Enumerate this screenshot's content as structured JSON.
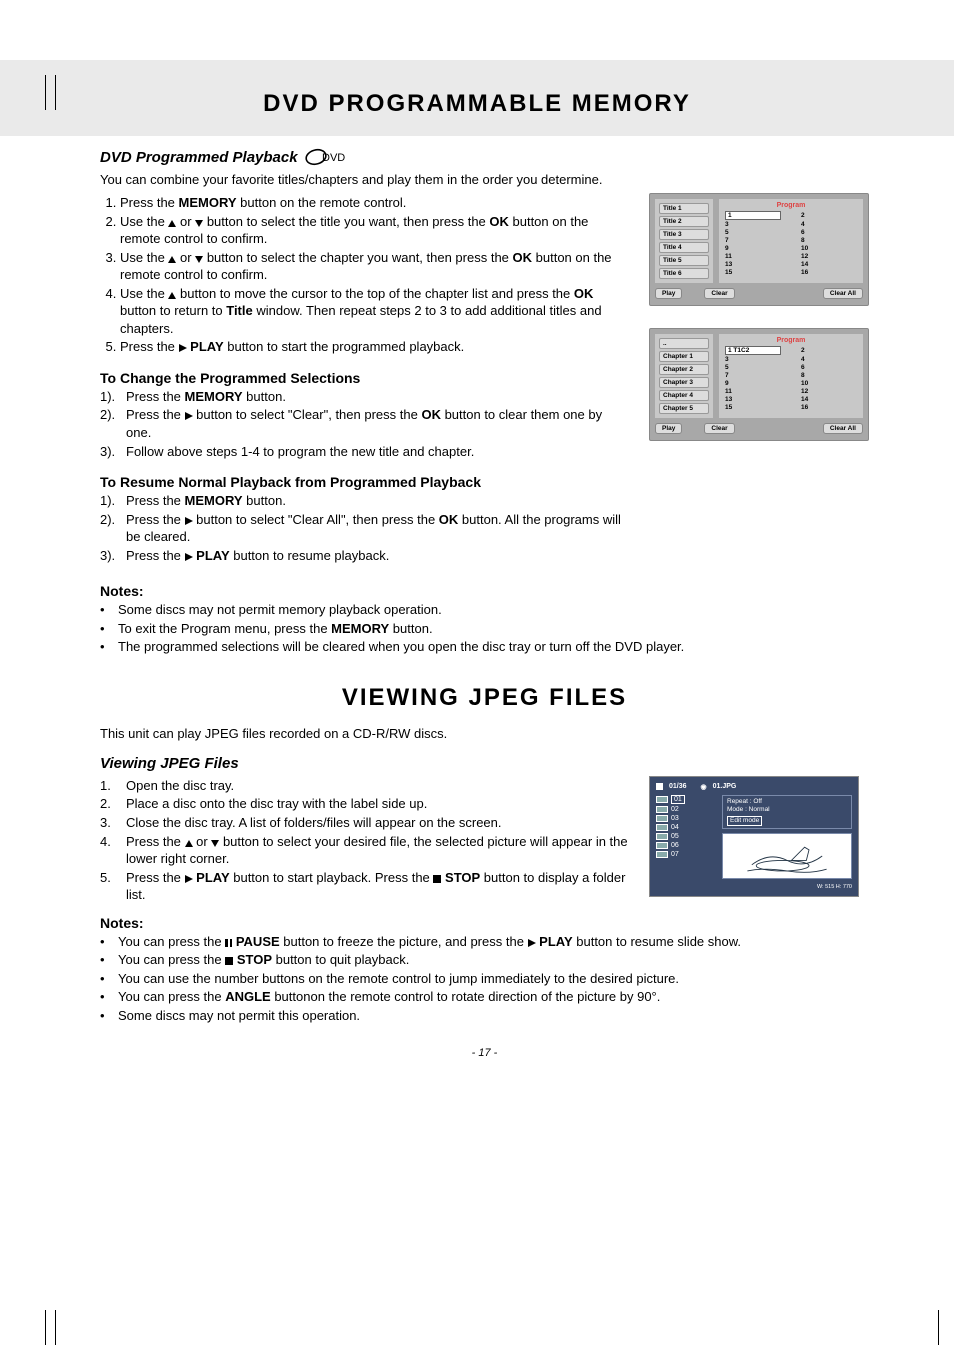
{
  "header1": "DVD PROGRAMMABLE MEMORY",
  "sec1": {
    "title": "DVD Programmed Playback",
    "badge": "DVD",
    "intro": "You can combine your favorite titles/chapters and play them in the order you determine.",
    "step1_a": "Press the ",
    "step1_b": "MEMORY",
    "step1_c": " button on the remote control.",
    "step2_a": "Use the ",
    "step2_b": " or ",
    "step2_c": " button to select the title you want, then press the ",
    "step2_d": "OK",
    "step2_e": " button on the remote control to confirm.",
    "step3_a": "Use the ",
    "step3_b": " or ",
    "step3_c": " button to select the chapter you want, then press the ",
    "step3_d": "OK",
    "step3_e": " button on the remote control to confirm.",
    "step4_a": "Use the ",
    "step4_b": " button to move the cursor to the top of the chapter list and press the ",
    "step4_c": "OK",
    "step4_d": " button to return to ",
    "step4_e": "Title",
    "step4_f": " window. Then repeat steps 2 to 3 to add additional titles and chapters.",
    "step5_a": "Press the ",
    "step5_b": " PLAY",
    "step5_c": " button to start the programmed playback."
  },
  "change": {
    "h": "To Change the Programmed Selections",
    "s1a": "Press the ",
    "s1b": "MEMORY",
    "s1c": " button.",
    "s2a": "Press the ",
    "s2b": " button to select \"Clear\", then press the ",
    "s2c": "OK",
    "s2d": " button to clear them one by one.",
    "s3": "Follow above steps 1-4 to program the new title and chapter."
  },
  "resume": {
    "h": "To Resume Normal Playback from Programmed Playback",
    "s1a": "Press the ",
    "s1b": "MEMORY",
    "s1c": " button.",
    "s2a": "Press the ",
    "s2b": " button to select \"Clear All\", then press the ",
    "s2c": "OK",
    "s2d": " button. All the programs will be cleared.",
    "s3a": "Press the ",
    "s3b": " PLAY",
    "s3c": " button to resume playback."
  },
  "notes1": {
    "h": "Notes:",
    "n1": "Some discs may not permit memory playback operation.",
    "n2a": "To exit the Program menu, press the ",
    "n2b": "MEMORY",
    "n2c": " button.",
    "n3": "The programmed selections will be cleared when you open the disc tray or turn off the DVD player."
  },
  "header2": "VIEWING JPEG FILES",
  "sec2": {
    "intro": "This unit can play JPEG files recorded on a CD-R/RW discs.",
    "title": "Viewing JPEG Files",
    "s1": "Open the disc tray.",
    "s2": "Place a disc onto the disc tray with the label side up.",
    "s3": "Close the disc tray. A list of folders/files will appear on the screen.",
    "s4a": "Press the ",
    "s4b": " or ",
    "s4c": " button to select your desired file, the selected picture will appear in the lower right corner.",
    "s5a": "Press the ",
    "s5b": " PLAY",
    "s5c": " button to start playback. Press the ",
    "s5d": " STOP",
    "s5e": " button to display a folder list."
  },
  "notes2": {
    "h": "Notes:",
    "n1a": "You can press the ",
    "n1b": " PAUSE",
    "n1c": " button to freeze the picture, and press the ",
    "n1d": " PLAY",
    "n1e": " button to resume slide show.",
    "n2a": "You can press the ",
    "n2b": " STOP",
    "n2c": " button to quit playback.",
    "n3": "You can use the number buttons on the remote control to jump immediately to the desired picture.",
    "n4a": "You can press the ",
    "n4b": "ANGLE",
    "n4c": " buttonon the remote control to rotate direction of the picture by 90°.",
    "n5": "Some discs may not permit this operation."
  },
  "osd1": {
    "program": "Program",
    "left": [
      "Title 1",
      "Title 2",
      "Title 3",
      "Title 4",
      "Title 5",
      "Title 6"
    ],
    "nums": [
      "1",
      "2",
      "3",
      "4",
      "5",
      "6",
      "7",
      "8",
      "9",
      "10",
      "11",
      "12",
      "13",
      "14",
      "15",
      "16"
    ],
    "play": "Play",
    "clear": "Clear",
    "clearall": "Clear All"
  },
  "osd2": {
    "program": "Program",
    "left_top": "..",
    "left": [
      "Chapter 1",
      "Chapter 2",
      "Chapter 3",
      "Chapter 4",
      "Chapter 5"
    ],
    "sel": "1  T1C2",
    "nums": [
      "2",
      "3",
      "4",
      "5",
      "6",
      "7",
      "8",
      "9",
      "10",
      "11",
      "12",
      "13",
      "14",
      "15",
      "16"
    ],
    "play": "Play",
    "clear": "Clear",
    "clearall": "Clear All"
  },
  "jpeg": {
    "counter": "01/36",
    "file": "01.JPG",
    "list": [
      "01",
      "02",
      "03",
      "04",
      "05",
      "06",
      "07"
    ],
    "repeat": "Repeat : Off",
    "mode": "Mode    : Normal",
    "edit": "Edit mode",
    "dim": "W: 515  H: 770"
  },
  "pagenum": "- 17 -"
}
